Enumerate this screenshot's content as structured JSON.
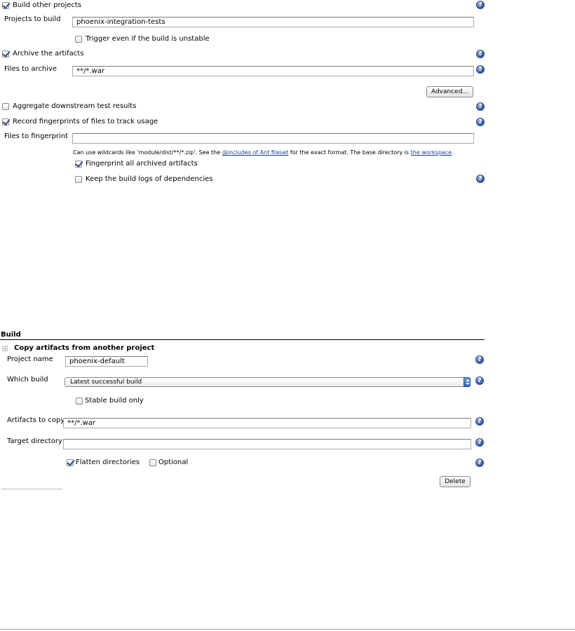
{
  "post_build": {
    "build_other_projects": {
      "label": "Build other projects",
      "checked": true
    },
    "projects_to_build": {
      "label": "Projects to build",
      "value": "phoenix-integration-tests"
    },
    "trigger_unstable": {
      "label": "Trigger even if the build is unstable",
      "checked": false
    },
    "archive_artifacts": {
      "label": "Archive the artifacts",
      "checked": true
    },
    "files_to_archive": {
      "label": "Files to archive",
      "value": "**/*.war"
    },
    "advanced_button": "Advanced...",
    "aggregate_results": {
      "label": "Aggregate downstream test results",
      "checked": false
    },
    "record_fingerprints": {
      "label": "Record fingerprints of files to track usage",
      "checked": true
    },
    "files_to_fingerprint": {
      "label": "Files to fingerprint",
      "value": ""
    },
    "wildcard_hint": {
      "prefix": "Can use wildcards like 'module/dist/**/*.zip'. See the ",
      "link1": "@includes of Ant fileset",
      "middle": " for the exact format. The base directory is ",
      "link2": "the workspace",
      "suffix": "."
    },
    "fingerprint_archived": {
      "label": "Fingerprint all archived artifacts",
      "checked": true
    },
    "keep_build_logs": {
      "label": "Keep the build logs of dependencies",
      "checked": false
    }
  },
  "build": {
    "section_title": "Build",
    "step_title": "Copy artifacts from another project",
    "project_name": {
      "label": "Project name",
      "value": "phoenix-default"
    },
    "which_build": {
      "label": "Which build",
      "selected": "Latest successful build"
    },
    "stable_only": {
      "label": "Stable build only",
      "checked": false
    },
    "artifacts_to_copy": {
      "label": "Artifacts to copy",
      "value": "**/*.war"
    },
    "target_directory": {
      "label": "Target directory",
      "value": ""
    },
    "flatten": {
      "label": "Flatten directories",
      "checked": true
    },
    "optional": {
      "label": "Optional",
      "checked": false
    },
    "delete_button": "Delete"
  },
  "icons": {
    "help": "help-icon",
    "drag": "drag-handle-icon",
    "check": "checkbox-icon"
  },
  "colors": {
    "link": "#1d3f9c",
    "help_icon": "#35569a",
    "select_arrow": "#2f64b8"
  }
}
